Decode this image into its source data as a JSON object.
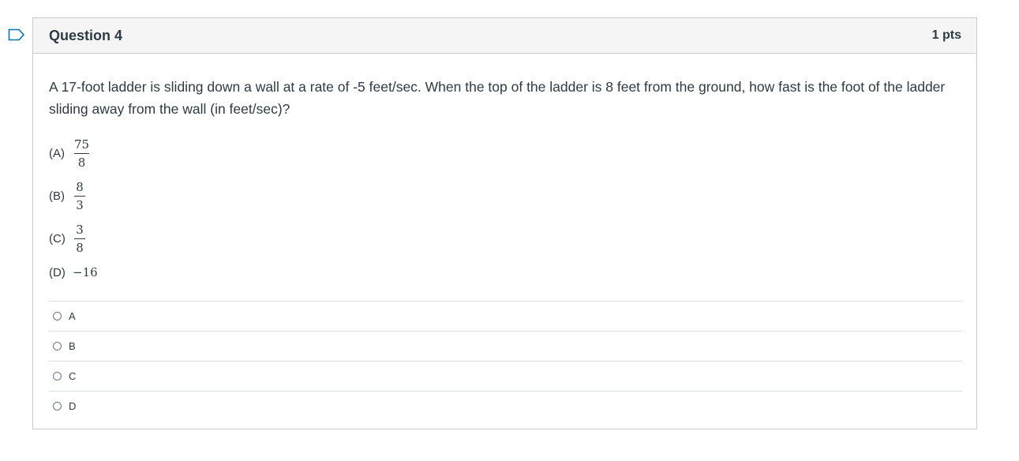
{
  "question": {
    "title": "Question 4",
    "points": "1 pts",
    "prompt": "A 17-foot ladder is sliding down a wall at a rate of -5 feet/sec. When the top of the ladder is 8 feet from the ground, how fast is the foot of the ladder sliding away from the wall (in feet/sec)?",
    "choices": [
      {
        "label": "(A)",
        "num": "75",
        "den": "8"
      },
      {
        "label": "(B)",
        "num": "8",
        "den": "3"
      },
      {
        "label": "(C)",
        "num": "3",
        "den": "8"
      },
      {
        "label": "(D)",
        "value": "−16"
      }
    ],
    "options": [
      {
        "label": "A",
        "selected": false
      },
      {
        "label": "B",
        "selected": false
      },
      {
        "label": "C",
        "selected": false
      },
      {
        "label": "D",
        "selected": false
      }
    ]
  },
  "flag_icon": "flag-outline-icon",
  "colors": {
    "flag": "#0374b5",
    "text": "#2d3b45",
    "border": "#c7cdd1",
    "header_bg": "#f5f5f5"
  }
}
